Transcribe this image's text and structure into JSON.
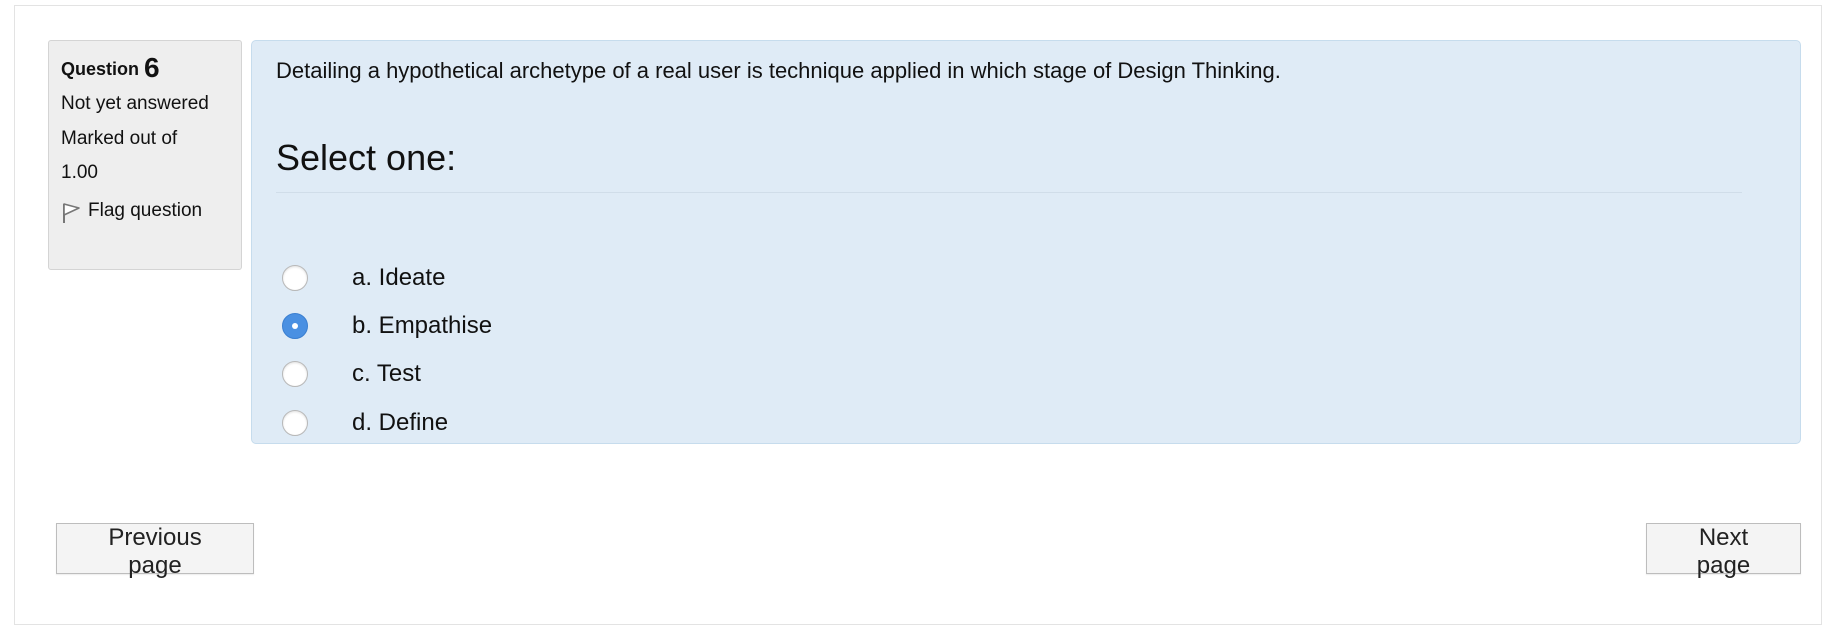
{
  "question_info": {
    "question_label": "Question",
    "question_number": "6",
    "state": "Not yet answered",
    "grade_line1": "Marked out of",
    "grade_line2": "1.00",
    "flag_label": "Flag question"
  },
  "question": {
    "text": "Detailing a hypothetical archetype of a real user is technique applied in which stage of Design Thinking.",
    "prompt": "Select one:",
    "options": [
      {
        "label": "a. Ideate",
        "selected": false
      },
      {
        "label": "b. Empathise",
        "selected": true
      },
      {
        "label": "c. Test",
        "selected": false
      },
      {
        "label": "d. Define",
        "selected": false
      }
    ]
  },
  "navigation": {
    "previous_label": "Previous page",
    "next_label": "Next page"
  },
  "colors": {
    "content_background": "#dfebf6",
    "info_background": "#eeeeee",
    "radio_selected": "#4a90e2"
  }
}
